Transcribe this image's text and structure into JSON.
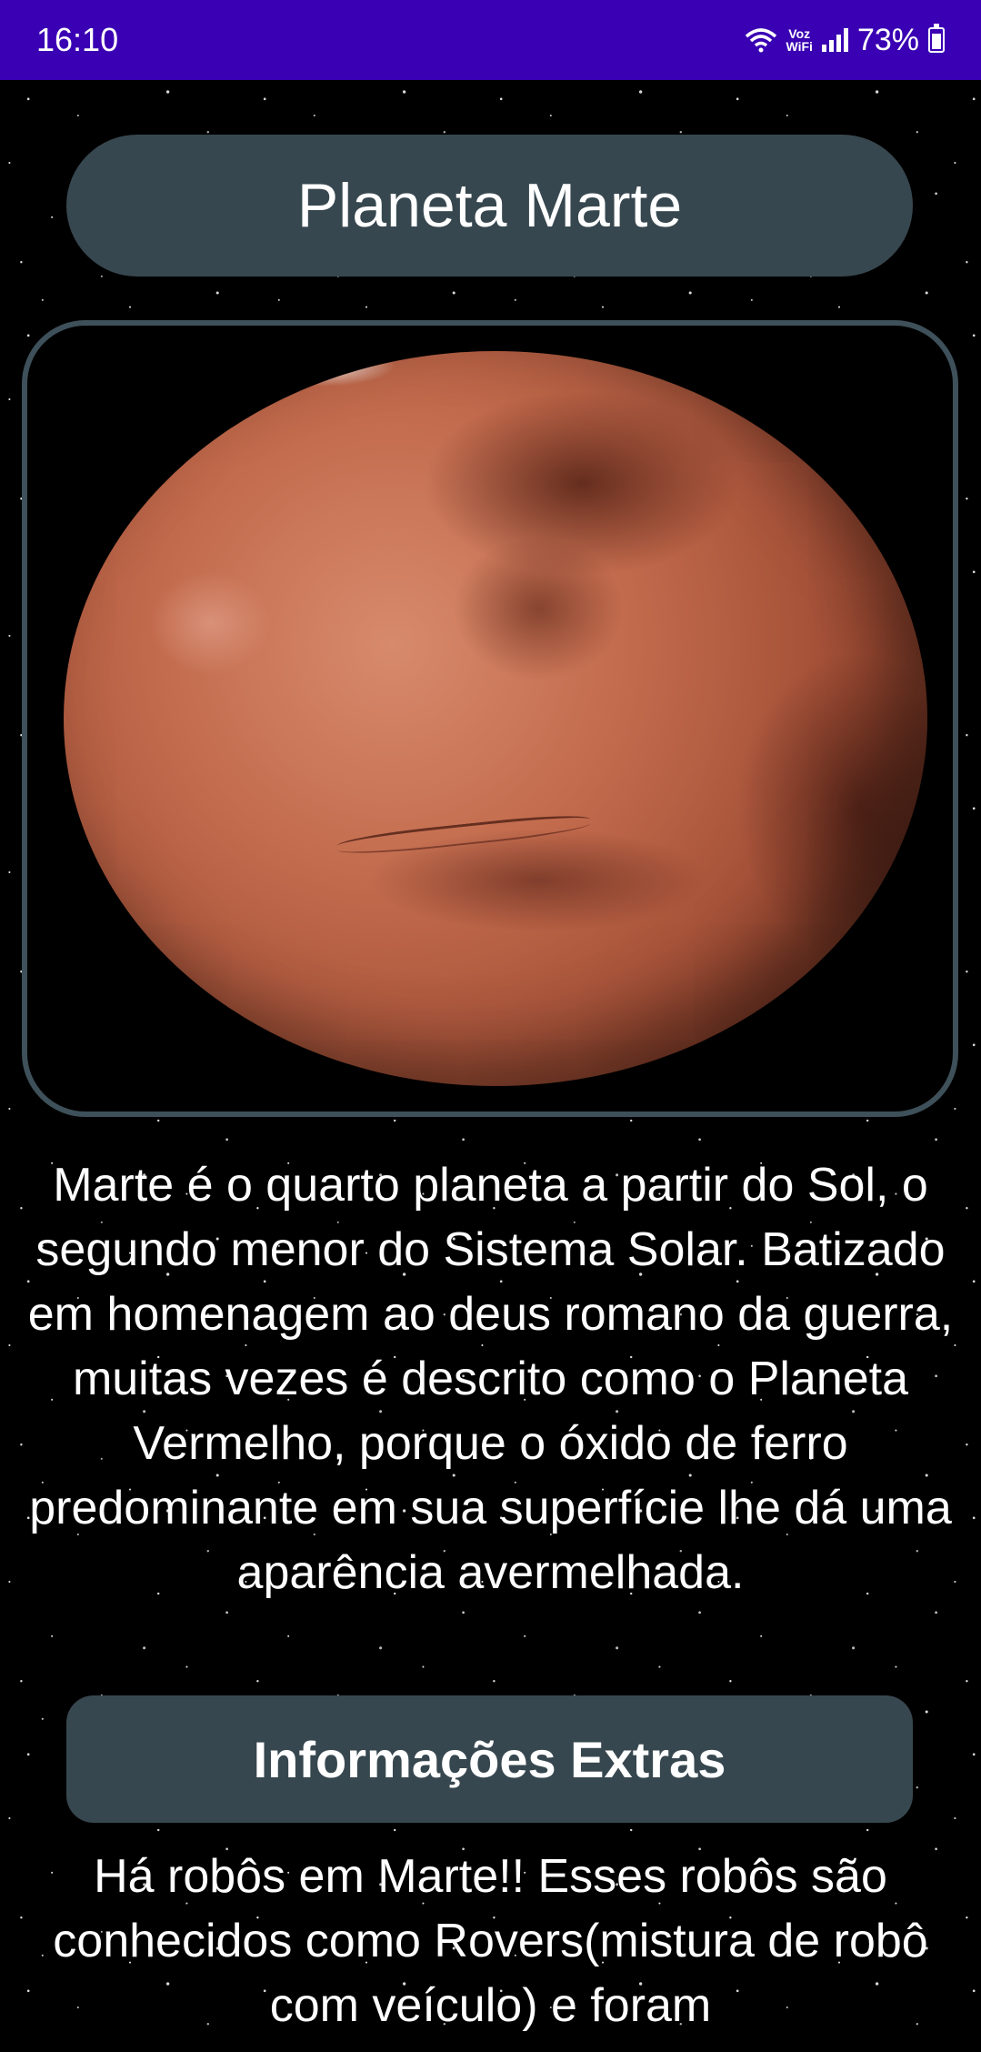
{
  "status_bar": {
    "time": "16:10",
    "network_label": "Voz WiFi",
    "battery": "73%",
    "battery_level": 0.73
  },
  "header": {
    "title": "Planeta Marte"
  },
  "image": {
    "subject": "mars-planet-image"
  },
  "description": "Marte é o quarto planeta a partir do Sol, o segundo menor do Sistema Solar. Batizado em homenagem ao deus romano da guerra, muitas vezes é descrito como o Planeta Vermelho, porque o óxido de ferro predominante em sua superfície lhe dá uma aparência avermelhada.",
  "extra": {
    "button_label": "Informações Extras",
    "text": "Há robôs em Marte!! Esses robôs são conhecidos como Rovers(mistura de robô com veículo) e foram"
  },
  "colors": {
    "status_bar": "#3a00b3",
    "pill": "#37474f",
    "frame_border": "#3e5059",
    "background": "#000000"
  }
}
